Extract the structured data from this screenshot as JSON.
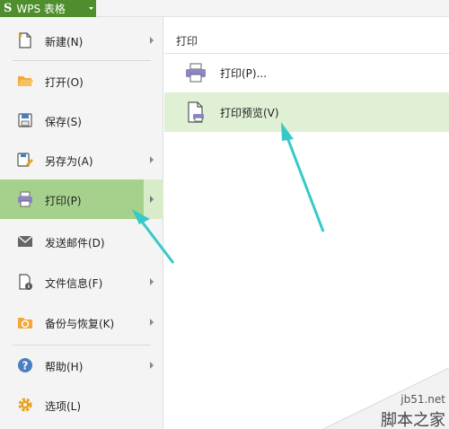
{
  "app": {
    "logo_glyph": "S",
    "title": "WPS 表格",
    "accent": "#4f8e2c"
  },
  "menu": {
    "items": [
      {
        "key": "new",
        "label": "新建(N)",
        "icon": "new-file-icon",
        "has_submenu": true
      },
      {
        "key": "open",
        "label": "打开(O)",
        "icon": "folder-open-icon",
        "has_submenu": false
      },
      {
        "key": "save",
        "label": "保存(S)",
        "icon": "save-icon",
        "has_submenu": false
      },
      {
        "key": "saveas",
        "label": "另存为(A)",
        "icon": "save-as-icon",
        "has_submenu": true
      },
      {
        "key": "print",
        "label": "打印(P)",
        "icon": "printer-icon",
        "has_submenu": true,
        "active": true
      },
      {
        "key": "send",
        "label": "发送邮件(D)",
        "icon": "mail-icon",
        "has_submenu": false
      },
      {
        "key": "info",
        "label": "文件信息(F)",
        "icon": "file-info-icon",
        "has_submenu": true
      },
      {
        "key": "backup",
        "label": "备份与恢复(K)",
        "icon": "backup-icon",
        "has_submenu": true
      },
      {
        "key": "help",
        "label": "帮助(H)",
        "icon": "help-icon",
        "has_submenu": true
      },
      {
        "key": "options",
        "label": "选项(L)",
        "icon": "gear-icon",
        "has_submenu": false
      }
    ],
    "active_color": "#a6d18c"
  },
  "submenu": {
    "title": "打印",
    "items": [
      {
        "label": "打印(P)...",
        "icon": "printer-icon"
      },
      {
        "label": "打印预览(V)",
        "icon": "print-preview-icon",
        "hover": true
      }
    ],
    "hover_color": "#dff0d5"
  },
  "annotation": {
    "arrow_color": "#36c9c9",
    "arrow_icon": "pointer-arrow-icon"
  },
  "watermark": {
    "site": "jb51.net",
    "name": "脚本之家"
  }
}
